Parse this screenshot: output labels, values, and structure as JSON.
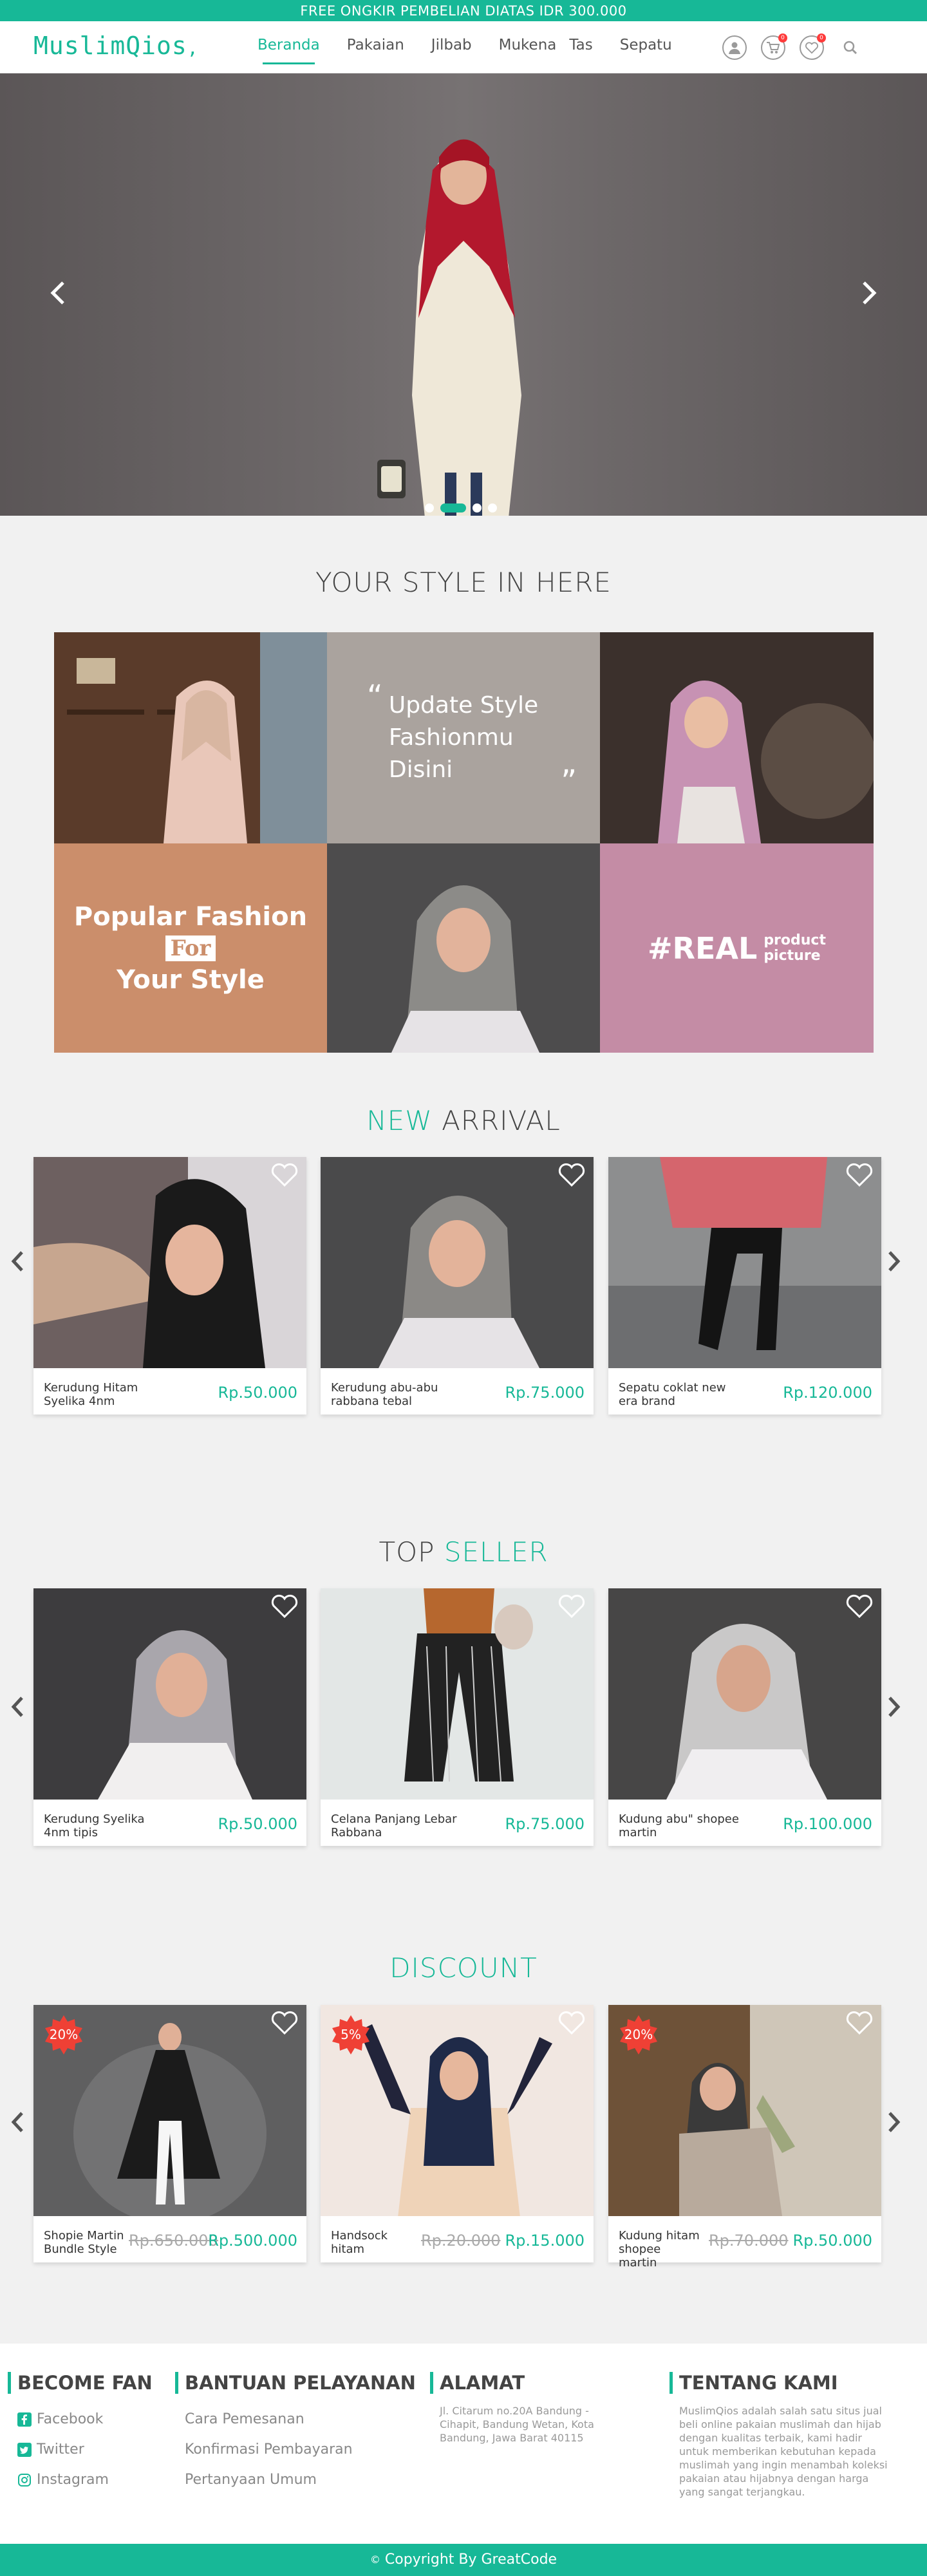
{
  "promo": "FREE ONGKIR PEMBELIAN DIATAS IDR 300.000",
  "brand": {
    "logo_text": "MuslimQios",
    "accent": "#17b897"
  },
  "nav": {
    "items": [
      "Beranda",
      "Pakaian",
      "Jilbab",
      "Mukena",
      "Tas",
      "Sepatu"
    ],
    "active": "Beranda",
    "cart_badge": "0",
    "wishlist_badge": "0"
  },
  "style_section": {
    "title": "YOUR STYLE IN HERE",
    "quote_open": "“",
    "quote_lines": [
      "Update Style",
      "Fashionmu",
      "Disini"
    ],
    "quote_close": "”",
    "popular_line1": "Popular Fashion",
    "popular_for": "For",
    "popular_line3": "Your Style",
    "real_main": "#REAL",
    "real_sub1": "product",
    "real_sub2": "picture"
  },
  "new_arrival": {
    "title_accent": "NEW",
    "title_rest": "ARRIVAL",
    "products": [
      {
        "name": "Kerudung Hitam Syelika 4nm",
        "price": "Rp.50.000"
      },
      {
        "name": "Kerudung abu-abu rabbana tebal",
        "price": "Rp.75.000"
      },
      {
        "name": "Sepatu coklat new era brand",
        "price": "Rp.120.000"
      }
    ]
  },
  "top_seller": {
    "title_rest": "TOP",
    "title_accent": "SELLER",
    "products": [
      {
        "name": "Kerudung Syelika 4nm tipis",
        "price": "Rp.50.000"
      },
      {
        "name": "Celana Panjang Lebar Rabbana",
        "price": "Rp.75.000"
      },
      {
        "name": "Kudung abu\" shopee martin",
        "price": "Rp.100.000"
      }
    ]
  },
  "discount": {
    "title": "DISCOUNT",
    "products": [
      {
        "name": "Shopie Martin Bundle Style",
        "old_price": "Rp.650.000",
        "price": "Rp.500.000",
        "badge": "20%"
      },
      {
        "name": "Handsock hitam",
        "old_price": "Rp.20.000",
        "price": "Rp.15.000",
        "badge": "5%"
      },
      {
        "name": "Kudung hitam shopee martin",
        "old_price": "Rp.70.000",
        "price": "Rp.50.000",
        "badge": "20%"
      }
    ]
  },
  "footer": {
    "fan": {
      "title": "BECOME FAN",
      "links": [
        "Facebook",
        "Twitter",
        "Instagram"
      ]
    },
    "service": {
      "title": "BANTUAN PELAYANAN",
      "links": [
        "Cara Pemesanan",
        "Konfirmasi Pembayaran",
        "Pertanyaan Umum"
      ]
    },
    "address": {
      "title": "ALAMAT",
      "text": "Jl. Citarum no.20A Bandung - Cihapit, Bandung Wetan, Kota Bandung, Jawa Barat 40115"
    },
    "about": {
      "title": "TENTANG KAMI",
      "text": "MuslimQios adalah salah satu situs jual beli online pakaian muslimah dan hijab dengan kualitas terbaik, kami hadir untuk memberikan kebutuhan kepada muslimah yang ingin menambah koleksi pakaian atau hijabnya dengan harga yang sangat terjangkau."
    }
  },
  "copyright": "Copyright By GreatCode"
}
